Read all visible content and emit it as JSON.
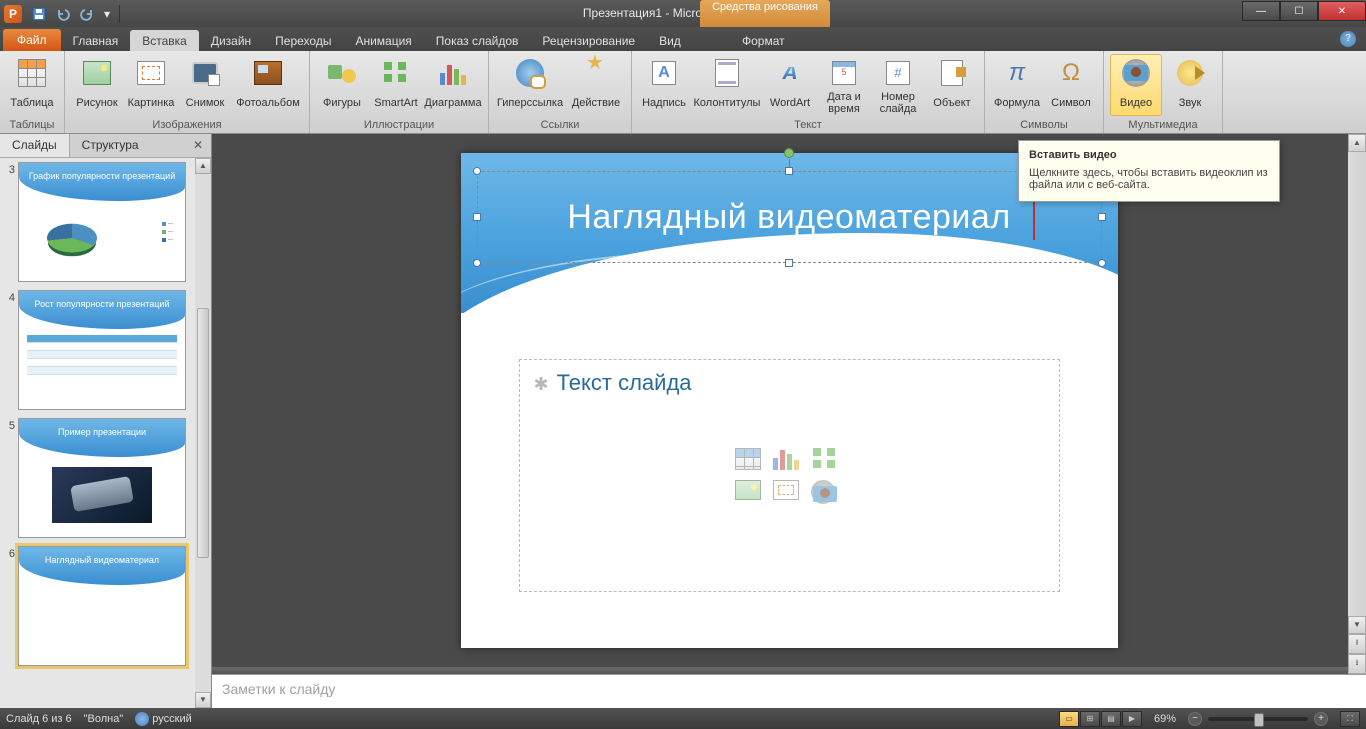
{
  "titlebar": {
    "app_initial": "P",
    "doc_title": "Презентация1 - Microsoft PowerPoint",
    "contextual_label": "Средства рисования"
  },
  "tabs": {
    "file": "Файл",
    "home": "Главная",
    "insert": "Вставка",
    "design": "Дизайн",
    "transitions": "Переходы",
    "animations": "Анимация",
    "slideshow": "Показ слайдов",
    "review": "Рецензирование",
    "view": "Вид",
    "format": "Формат"
  },
  "ribbon": {
    "groups": {
      "tables": "Таблицы",
      "images": "Изображения",
      "illustrations": "Иллюстрации",
      "links": "Ссылки",
      "text": "Текст",
      "symbols": "Символы",
      "media": "Мультимедиа"
    },
    "items": {
      "table": "Таблица",
      "picture": "Рисунок",
      "clipart": "Картинка",
      "screenshot": "Снимок",
      "photoalbum": "Фотоальбом",
      "shapes": "Фигуры",
      "smartart": "SmartArt",
      "chart": "Диаграмма",
      "hyperlink": "Гиперссылка",
      "action": "Действие",
      "textbox": "Надпись",
      "headerfooter": "Колонтитулы",
      "wordart": "WordArt",
      "datetime": "Дата и время",
      "slidenumber": "Номер слайда",
      "object": "Объект",
      "equation": "Формула",
      "symbol": "Символ",
      "video": "Видео",
      "audio": "Звук"
    }
  },
  "tooltip": {
    "title": "Вставить видео",
    "body": "Щелкните здесь, чтобы вставить видеоклип из файла или с веб-сайта."
  },
  "panel": {
    "tab_slides": "Слайды",
    "tab_outline": "Структура",
    "thumbs": [
      {
        "num": "3",
        "title": "График популярности презентаций"
      },
      {
        "num": "4",
        "title": "Рост популярности презентаций"
      },
      {
        "num": "5",
        "title": "Пример презентации"
      },
      {
        "num": "6",
        "title": "Наглядный видеоматериал"
      }
    ]
  },
  "slide": {
    "title": "Наглядный видеоматериал",
    "content_placeholder": "Текст слайда"
  },
  "notes": {
    "placeholder": "Заметки к слайду"
  },
  "status": {
    "slide_count": "Слайд 6 из 6",
    "theme": "\"Волна\"",
    "language": "русский",
    "zoom": "69%"
  }
}
